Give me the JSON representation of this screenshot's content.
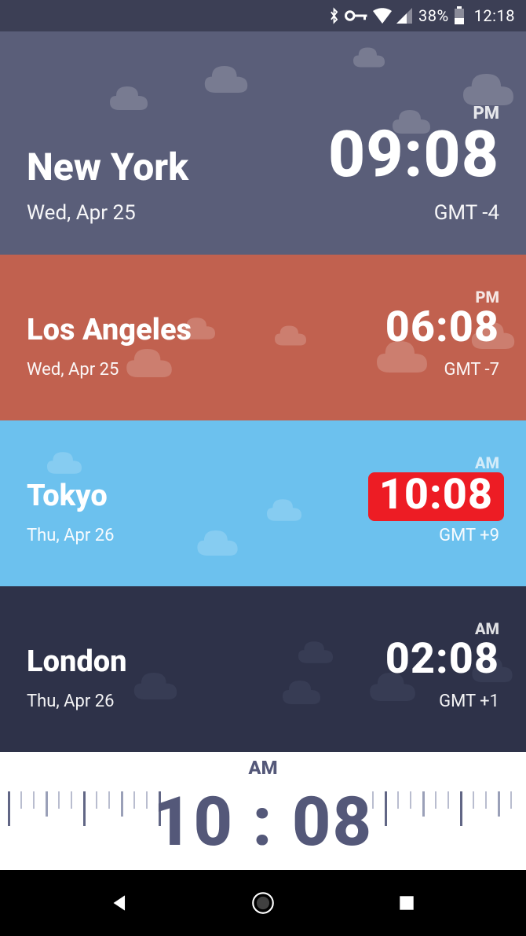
{
  "status": {
    "battery_pct": "38%",
    "time": "12:18"
  },
  "cards": [
    {
      "city": "New York",
      "date": "Wed, Apr 25",
      "ampm": "PM",
      "time": "09:08",
      "tz": "GMT -4",
      "highlight": false
    },
    {
      "city": "Los Angeles",
      "date": "Wed, Apr 25",
      "ampm": "PM",
      "time": "06:08",
      "tz": "GMT -7",
      "highlight": false
    },
    {
      "city": "Tokyo",
      "date": "Thu, Apr 26",
      "ampm": "AM",
      "time": "10:08",
      "tz": "GMT +9",
      "highlight": true
    },
    {
      "city": "London",
      "date": "Thu, Apr 26",
      "ampm": "AM",
      "time": "02:08",
      "tz": "GMT +1",
      "highlight": false
    }
  ],
  "slider": {
    "ampm": "AM",
    "time": "10 : 08"
  }
}
